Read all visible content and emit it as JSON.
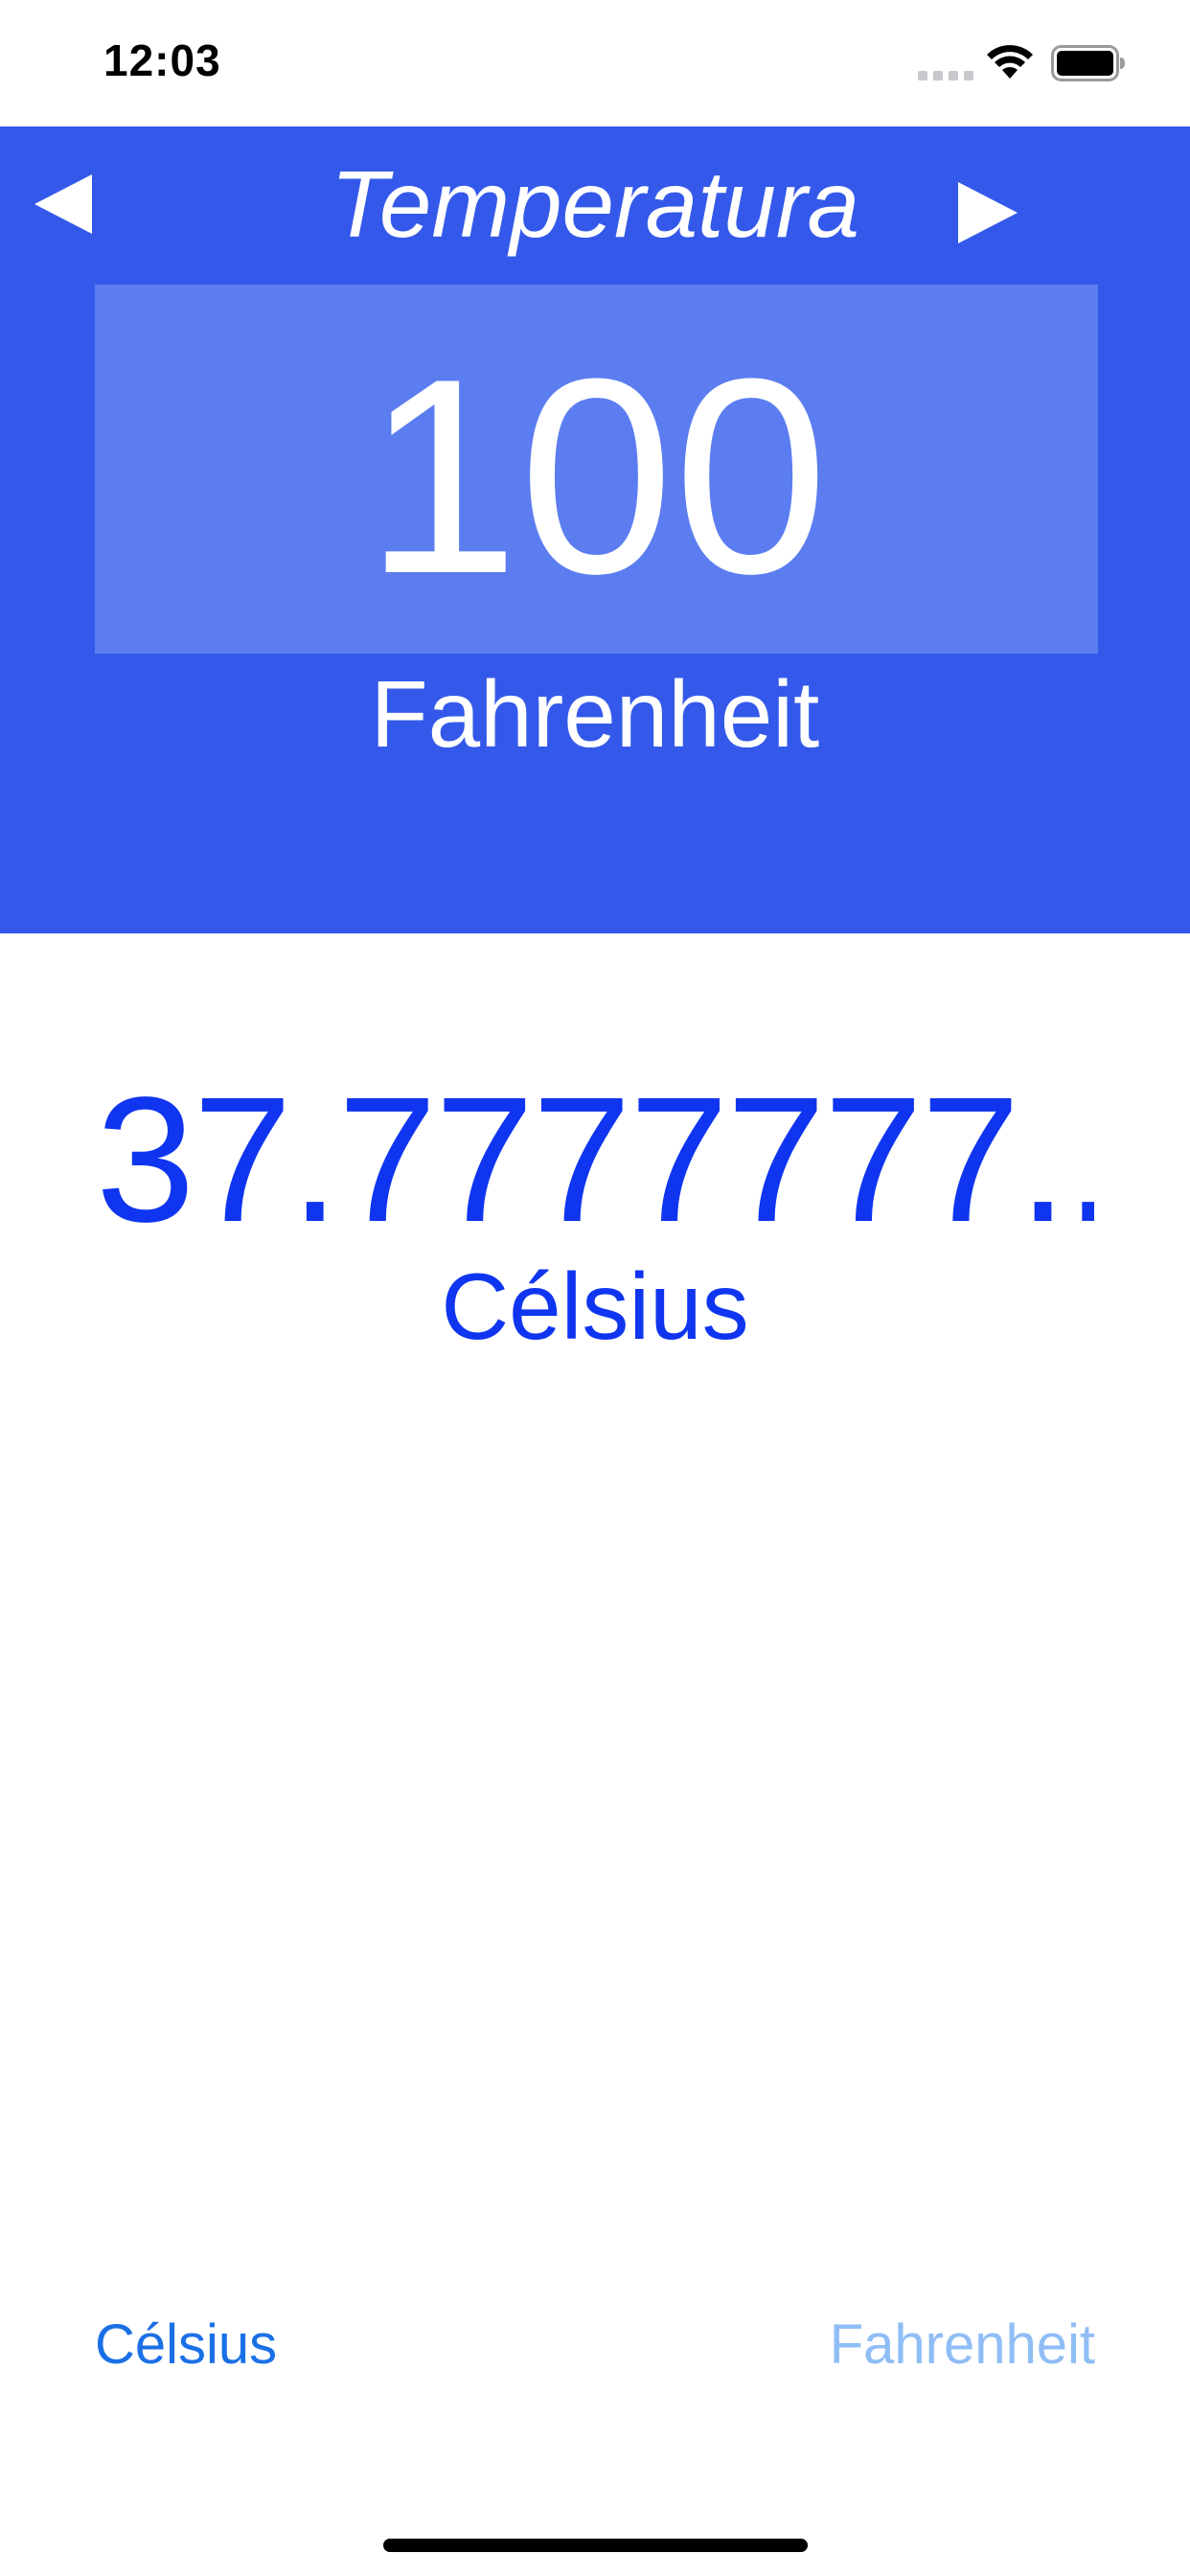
{
  "status_bar": {
    "time": "12:03",
    "signal_icon": "signal-dots-icon",
    "wifi_icon": "wifi-icon",
    "battery_icon": "battery-icon"
  },
  "header": {
    "title": "Temperatura",
    "prev_icon": "triangle-left-icon",
    "next_icon": "triangle-right-icon",
    "background_color": "#3459ea",
    "input_box_color": "#5b7df0"
  },
  "converter": {
    "input_value": "100",
    "input_unit": "Fahrenheit",
    "result_value": "37.7777777...",
    "result_unit": "Célsius",
    "result_color": "#0f35f0"
  },
  "unit_selector": {
    "options": [
      {
        "label": "Célsius",
        "selected": true,
        "color": "#1a70e6"
      },
      {
        "label": "Fahrenheit",
        "selected": false,
        "color": "#8fbdf6"
      }
    ]
  }
}
